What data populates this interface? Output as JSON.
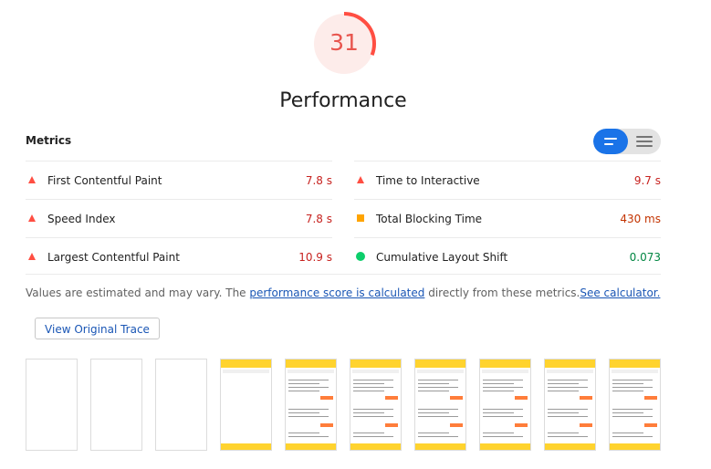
{
  "score": {
    "value": "31",
    "title": "Performance",
    "color": "#e8554e",
    "fraction": 0.31
  },
  "metrics": {
    "header": "Metrics",
    "left": [
      {
        "label": "First Contentful Paint",
        "value": "7.8 s",
        "status": "fail"
      },
      {
        "label": "Speed Index",
        "value": "7.8 s",
        "status": "fail"
      },
      {
        "label": "Largest Contentful Paint",
        "value": "10.9 s",
        "status": "fail"
      }
    ],
    "right": [
      {
        "label": "Time to Interactive",
        "value": "9.7 s",
        "status": "fail"
      },
      {
        "label": "Total Blocking Time",
        "value": "430 ms",
        "status": "average"
      },
      {
        "label": "Cumulative Layout Shift",
        "value": "0.073",
        "status": "pass"
      }
    ],
    "view_toggle": {
      "selected": "list"
    }
  },
  "note": {
    "prefix": "Values are estimated and may vary. The ",
    "link1": "performance score is calculated",
    "middle": " directly from these metrics.",
    "link2": "See calculator."
  },
  "trace_button": "View Original Trace",
  "filmstrip": {
    "frame_states": [
      "blank",
      "blank",
      "blank",
      "loading",
      "loaded",
      "loaded",
      "loaded",
      "loaded",
      "loaded",
      "loaded"
    ]
  },
  "colors": {
    "fail": "#ff4e42",
    "average": "#ffa400",
    "pass": "#0cce6b",
    "accent": "#1a73e8"
  }
}
